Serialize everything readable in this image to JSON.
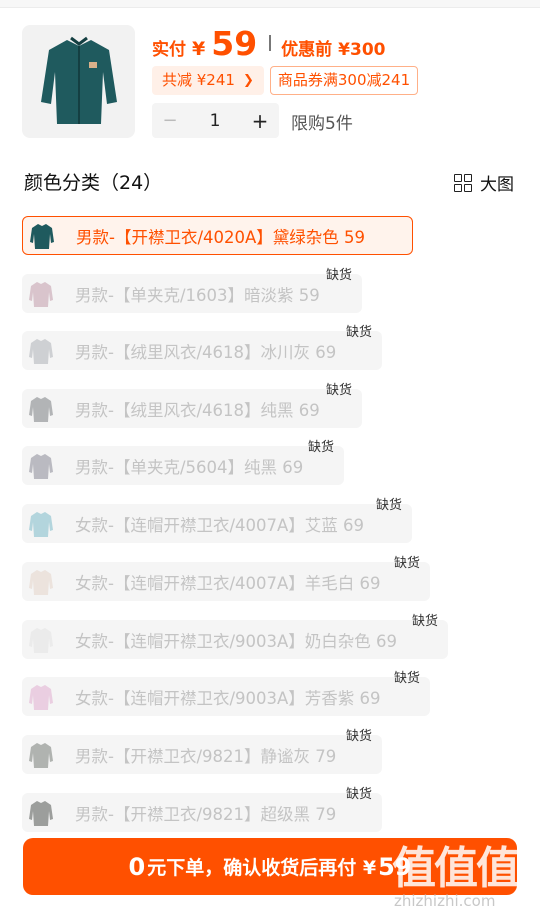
{
  "header": {
    "price_label": "实付",
    "currency": "¥",
    "price": "59",
    "original_label": "优惠前",
    "original_price": "¥300",
    "saved_text": "共减 ¥241",
    "coupon_text": "商品券满300减241",
    "quantity": "1",
    "minus": "−",
    "plus": "+",
    "limit_text": "限购5件"
  },
  "section": {
    "title": "颜色分类（24）",
    "big_view_label": "大图"
  },
  "out_of_stock_label": "缺货",
  "options": [
    {
      "label": "男款-【开襟卫衣/4020A】黛绿杂色 59",
      "selected": true,
      "out_of_stock": false,
      "swatch_color": "#1f5a5e"
    },
    {
      "label": "男款-【单夹克/1603】暗淡紫 59",
      "selected": false,
      "out_of_stock": true,
      "swatch_color": "#c9a9b6"
    },
    {
      "label": "男款-【绒里风衣/4618】冰川灰 69",
      "selected": false,
      "out_of_stock": true,
      "swatch_color": "#b9bcc0"
    },
    {
      "label": "男款-【绒里风衣/4618】纯黑 69",
      "selected": false,
      "out_of_stock": true,
      "swatch_color": "#8e9094"
    },
    {
      "label": "男款-【单夹克/5604】纯黑 69",
      "selected": false,
      "out_of_stock": true,
      "swatch_color": "#9a9aa4"
    },
    {
      "label": "女款-【连帽开襟卫衣/4007A】艾蓝 69",
      "selected": false,
      "out_of_stock": true,
      "swatch_color": "#8fc3d0"
    },
    {
      "label": "女款-【连帽开襟卫衣/4007A】羊毛白 69",
      "selected": false,
      "out_of_stock": true,
      "swatch_color": "#e6d8cf"
    },
    {
      "label": "女款-【连帽开襟卫衣/9003A】奶白杂色 69",
      "selected": false,
      "out_of_stock": true,
      "swatch_color": "#e5e5e5"
    },
    {
      "label": "女款-【连帽开襟卫衣/9003A】芳香紫 69",
      "selected": false,
      "out_of_stock": true,
      "swatch_color": "#e4b9d6"
    },
    {
      "label": "男款-【开襟卫衣/9821】静谧灰 79",
      "selected": false,
      "out_of_stock": true,
      "swatch_color": "#8a8f8a"
    },
    {
      "label": "男款-【开襟卫衣/9821】超级黑 79",
      "selected": false,
      "out_of_stock": true,
      "swatch_color": "#6b6f6c"
    }
  ],
  "cta": {
    "zero": "0",
    "text": "元下单，确认收货后再付 ¥",
    "amount": "59"
  },
  "watermark": {
    "glyphs": "值值值",
    "url": "zhizhizhi.com"
  },
  "colors": {
    "accent": "#ff5000",
    "disabled_text": "#c4c4c4",
    "option_bg": "#f5f5f5"
  }
}
